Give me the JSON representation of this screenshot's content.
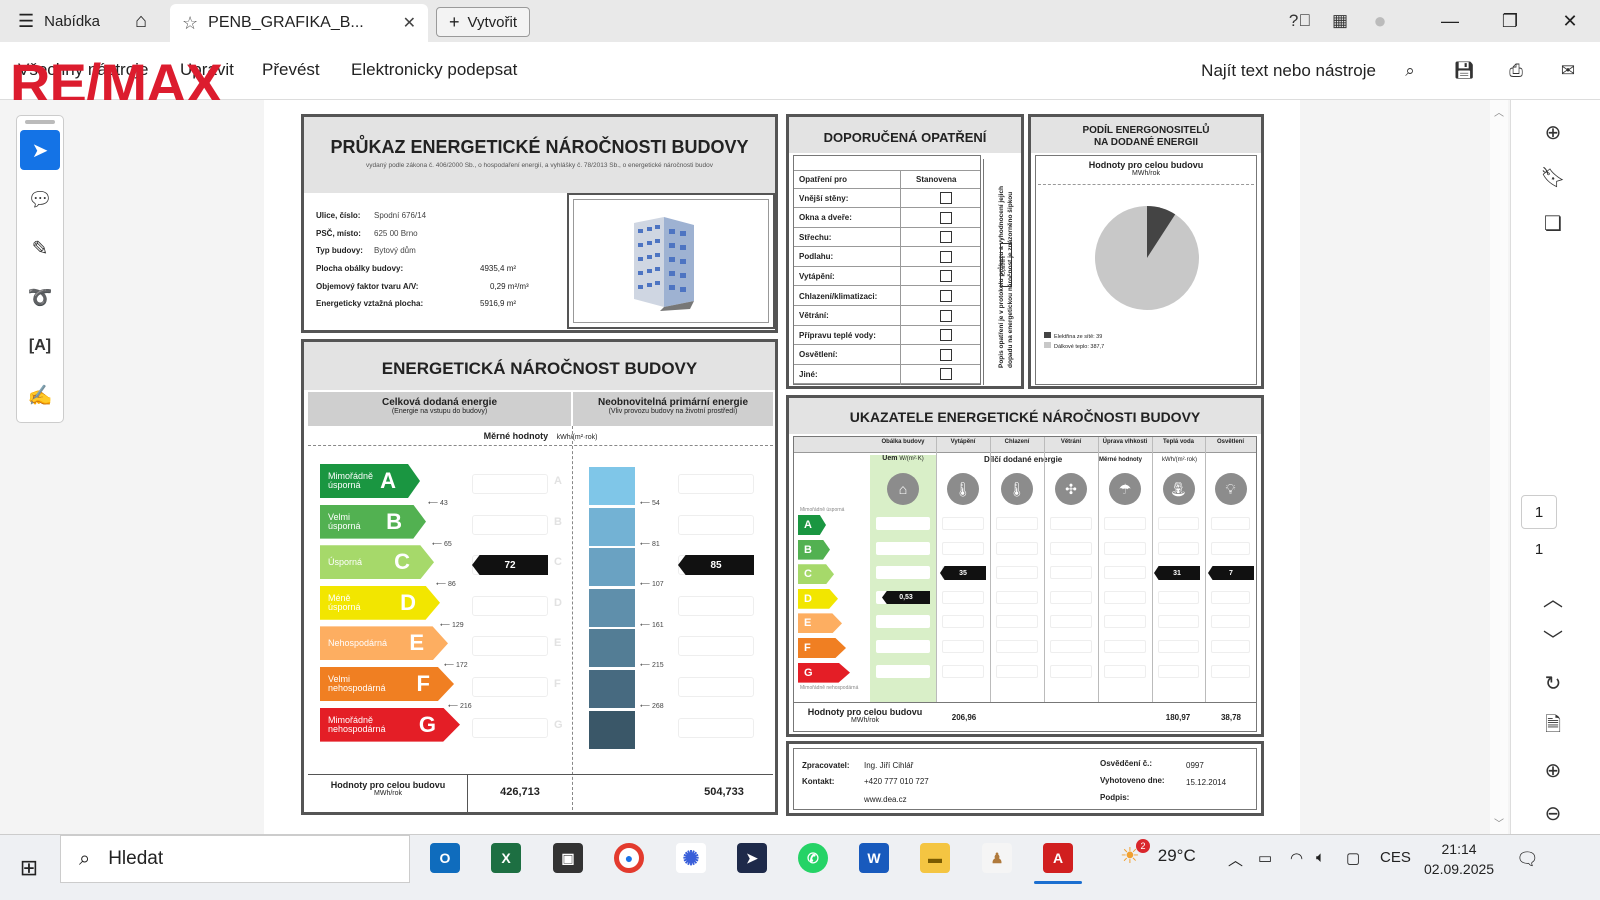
{
  "titlebar": {
    "menu_label": "Nabídka",
    "tab_title": "PENB_GRAFIKA_B...",
    "create_label": "Vytvořit"
  },
  "toolbar": {
    "menu": [
      "Všechny nástroje",
      "Upravit",
      "Převést",
      "Elektronicky podepsat"
    ],
    "find_label": "Najít text nebo nástroje"
  },
  "logo_text": "RE/MAX",
  "pages": {
    "current": "1",
    "total": "1"
  },
  "penb": {
    "title": "PRŮKAZ ENERGETICKÉ NÁROČNOSTI BUDOVY",
    "subtitle": "vydaný podle zákona č. 406/2000 Sb., o hospodaření energií, a vyhlášky č. 78/2013 Sb., o energetické náročnosti budov",
    "fields": {
      "street_label": "Ulice, číslo:",
      "street": "Spodní 676/14",
      "city_label": "PSČ, místo:",
      "city": "625 00  Brno",
      "type_label": "Typ budovy:",
      "type": "Bytový dům",
      "envelope_label": "Plocha obálky budovy:",
      "envelope": "4935,4 m²",
      "factor_label": "Objemový faktor tvaru A/V:",
      "factor": "0,29 m²/m³",
      "area_label": "Energeticky vztažná plocha:",
      "area": "5916,9 m²"
    },
    "main_title": "ENERGETICKÁ NÁROČNOST BUDOVY",
    "col1_title": "Celková dodaná energie",
    "col1_sub": "(Energie na vstupu do budovy)",
    "col2_title": "Neobnovitelná primární energie",
    "col2_sub": "(Vliv provozu budovy na životní prostředí)",
    "specific_label": "Měrné hodnoty",
    "specific_unit": "kWh/(m²·rok)",
    "classes": [
      {
        "name": "Mimořádně úsporná",
        "letter": "A",
        "color": "#1a9641"
      },
      {
        "name": "Velmi úsporná",
        "letter": "B",
        "color": "#52b151"
      },
      {
        "name": "Úsporná",
        "letter": "C",
        "color": "#a6d96a"
      },
      {
        "name": "Méně úsporná",
        "letter": "D",
        "color": "#f2e600"
      },
      {
        "name": "Nehospodárná",
        "letter": "E",
        "color": "#fdae61"
      },
      {
        "name": "Velmi nehospodárná",
        "letter": "F",
        "color": "#f07f22"
      },
      {
        "name": "Mimořádně nehospodárná",
        "letter": "G",
        "color": "#e41e26"
      }
    ],
    "delivered_ticks": [
      "43",
      "65",
      "86",
      "129",
      "172",
      "216"
    ],
    "primary_ticks": [
      "54",
      "81",
      "107",
      "161",
      "215",
      "268"
    ],
    "delivered_value": "72",
    "primary_value": "85",
    "total_label": "Hodnoty pro celou budovu",
    "total_unit": "MWh/rok",
    "total_delivered": "426,713",
    "total_primary": "504,733",
    "measures_title": "DOPORUČENÁ OPATŘENÍ",
    "measures_head_left": "Opatření pro",
    "measures_head_right": "Stanovena",
    "measures": [
      "Vnější stěny:",
      "Okna a dveře:",
      "Střechu:",
      "Podlahu:",
      "Vytápění:",
      "Chlazení/klimatizaci:",
      "Větrání:",
      "Přípravu teplé vody:",
      "Osvětlení:",
      "Jiné:"
    ],
    "measures_note": "Popis opatření je v protokolu průkazu a vyhodnocení jejich dopadu na energetickou náročnost je znázorněno šipkou",
    "measures_note_tag": "Opatření",
    "share_title_1": "PODÍL ENERGONOSITELŮ",
    "share_title_2": "NA DODANÉ ENERGII",
    "share_sub": "Hodnoty pro celou budovu",
    "share_unit": "MWh/rok",
    "share_legend": [
      "Elektřina ze sítě: 39",
      "Dálkové teplo: 387,7"
    ],
    "chart_data": {
      "type": "pie",
      "title": "Hodnoty pro celou budovu",
      "labels": [
        "Elektřina ze sítě",
        "Dálkové teplo"
      ],
      "values": [
        39,
        387.7
      ],
      "colors": [
        "#444444",
        "#c8c8c8"
      ]
    },
    "indicators_title": "UKAZATELE ENERGETICKÉ NÁROČNOSTI BUDOVY",
    "indicators_cols": [
      "Obálka budovy",
      "Vytápění",
      "Chlazení",
      "Větrání",
      "Úprava vlhkosti",
      "Teplá voda",
      "Osvětlení"
    ],
    "uem_label": "Uem",
    "uem_unit": "W/(m²·K)",
    "partial_label": "Dílčí dodané energie",
    "partial_specific": "Měrné hodnoty",
    "partial_unit": "kWh/(m²·rok)",
    "indicators_top_label": "Mimořádně úsporná",
    "indicators_bottom_label": "Mimořádně nehospodárná",
    "uem_value": "0,53",
    "heating_value": "35",
    "hot_water_value": "31",
    "lighting_value": "7",
    "ind_total_label": "Hodnoty pro celou budovu",
    "ind_total_unit": "MWh/rok",
    "ind_total_heating": "206,96",
    "ind_total_hot_water": "180,97",
    "ind_total_lighting": "38,78",
    "footer": {
      "processor_label": "Zpracovatel:",
      "processor": "Ing. Jiří Cihlář",
      "contact_label": "Kontakt:",
      "phone": "+420 777 010 727",
      "web": "www.dea.cz",
      "cert_label": "Osvědčení č.:",
      "cert": "0997",
      "created_label": "Vyhotoveno dne:",
      "created": "15.12.2014",
      "sign_label": "Podpis:"
    }
  },
  "taskbar": {
    "search_placeholder": "Hledat",
    "weather_temp": "29°C",
    "weather_badge": "2",
    "language": "CES",
    "time": "21:14",
    "date": "02.09.2025"
  }
}
